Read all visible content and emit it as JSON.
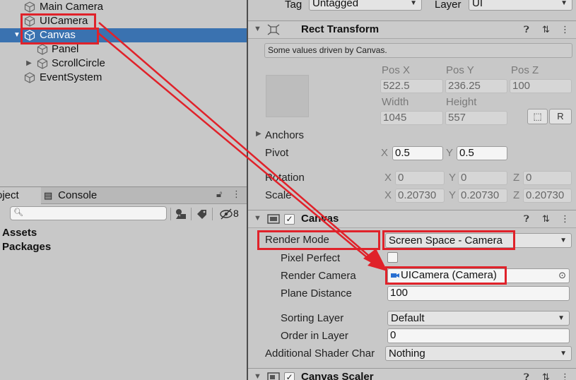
{
  "hierarchy": {
    "items": [
      {
        "label": "Main Camera",
        "indent": 1,
        "expanded": false,
        "has_children": false,
        "selected": false
      },
      {
        "label": "UICamera",
        "indent": 1,
        "expanded": false,
        "has_children": false,
        "selected": false
      },
      {
        "label": "Canvas",
        "indent": 1,
        "expanded": true,
        "has_children": true,
        "selected": true
      },
      {
        "label": "Panel",
        "indent": 2,
        "expanded": false,
        "has_children": false,
        "selected": false
      },
      {
        "label": "ScrollCircle",
        "indent": 2,
        "expanded": false,
        "has_children": true,
        "selected": false
      },
      {
        "label": "EventSystem",
        "indent": 1,
        "expanded": false,
        "has_children": false,
        "selected": false
      }
    ]
  },
  "project_panel": {
    "tabs": [
      {
        "label": "roject",
        "icon": "folder-icon",
        "active": true
      },
      {
        "label": "Console",
        "icon": "console-icon",
        "active": false
      }
    ],
    "search": {
      "value": "",
      "placeholder": ""
    },
    "hidden_count": "8",
    "items": [
      "Assets",
      "Packages"
    ]
  },
  "inspector": {
    "tag": {
      "label": "Tag",
      "value": "Untagged"
    },
    "layer": {
      "label": "Layer",
      "value": "UI"
    },
    "rect_transform": {
      "title": "Rect Transform",
      "info": "Some values driven by Canvas.",
      "pos_x": {
        "label": "Pos X",
        "value": "522.5"
      },
      "pos_y": {
        "label": "Pos Y",
        "value": "236.25"
      },
      "pos_z": {
        "label": "Pos Z",
        "value": "100"
      },
      "width": {
        "label": "Width",
        "value": "1045"
      },
      "height": {
        "label": "Height",
        "value": "557"
      },
      "raw_button": "R",
      "anchors_label": "Anchors",
      "pivot": {
        "label": "Pivot",
        "x_label": "X",
        "x": "0.5",
        "y_label": "Y",
        "y": "0.5"
      },
      "rotation": {
        "label": "Rotation",
        "x_label": "X",
        "x": "0",
        "y_label": "Y",
        "y": "0",
        "z_label": "Z",
        "z": "0"
      },
      "scale": {
        "label": "Scale",
        "x_label": "X",
        "x": "0.20730",
        "y_label": "Y",
        "y": "0.20730",
        "z_label": "Z",
        "z": "0.20730"
      }
    },
    "canvas": {
      "title": "Canvas",
      "enabled": true,
      "render_mode": {
        "label": "Render Mode",
        "value": "Screen Space - Camera"
      },
      "pixel_perfect": {
        "label": "Pixel Perfect",
        "checked": false
      },
      "render_camera": {
        "label": "Render Camera",
        "value": "UICamera (Camera)"
      },
      "plane_distance": {
        "label": "Plane Distance",
        "value": "100"
      },
      "sorting_layer": {
        "label": "Sorting Layer",
        "value": "Default"
      },
      "order_in_layer": {
        "label": "Order in Layer",
        "value": "0"
      },
      "additional_shader": {
        "label": "Additional Shader Char",
        "value": "Nothing"
      }
    },
    "canvas_scaler": {
      "title": "Canvas Scaler",
      "enabled": true
    }
  },
  "colors": {
    "panel_bg": "#c8c8c8",
    "selection": "#3a72b0",
    "highlight": "#e0222a",
    "camera_icon": "#2a6fd1"
  },
  "icons": {
    "gameobject": "cube-icon",
    "help": "help-icon",
    "presets": "sliders-icon",
    "menu": "kebab-menu-icon",
    "lock": "lock-icon",
    "search": "search-icon",
    "target": "object-picker-icon"
  }
}
